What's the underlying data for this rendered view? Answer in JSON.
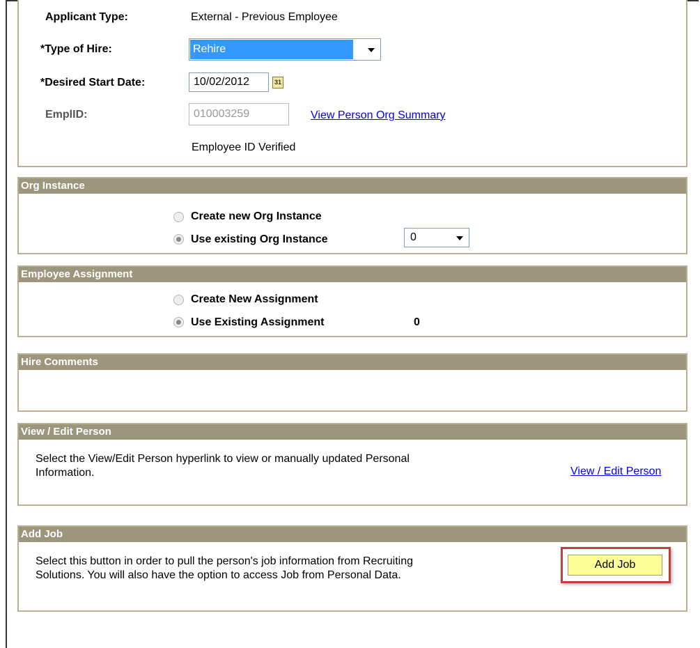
{
  "applicant": {
    "type_label": "Applicant Type:",
    "type_value": "External - Previous Employee",
    "hire_label": "*Type of Hire:",
    "hire_value": "Rehire",
    "start_label": "*Desired Start Date:",
    "start_value": "10/02/2012",
    "calendar_day": "31",
    "emplid_label": "EmplID:",
    "emplid_value": "010003259",
    "org_summary_link": "View Person Org Summary",
    "verified_text": "Employee ID Verified"
  },
  "org_instance": {
    "header": "Org Instance",
    "option_new": "Create new Org Instance",
    "option_existing": "Use existing Org Instance",
    "selected_value": "0"
  },
  "employee_assignment": {
    "header": "Employee Assignment",
    "option_new": "Create New Assignment",
    "option_existing": "Use Existing Assignment",
    "existing_value": "0"
  },
  "hire_comments": {
    "header": "Hire Comments"
  },
  "view_edit_person": {
    "header": "View / Edit Person",
    "text_line1": "Select the View/Edit Person hyperlink to view or manually updated Personal",
    "text_line2": "Information.",
    "link": "View / Edit Person"
  },
  "add_job": {
    "header": "Add Job",
    "text_line1": "Select this button in order to pull the person's job information from Recruiting",
    "text_line2": "Solutions. You will also have the option to access Job from Personal Data.",
    "button_label": "Add Job"
  },
  "colors": {
    "section_header_bg": "#9c967d",
    "section_border": "#b9b093",
    "hire_select_bg": "#3399ff",
    "button_bg": "#ffff99",
    "highlight_border": "#c04040",
    "link": "#0000ee"
  }
}
